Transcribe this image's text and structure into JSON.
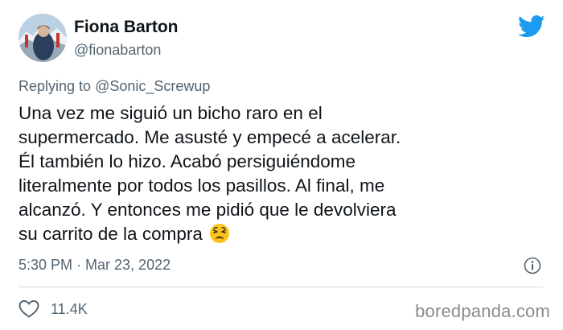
{
  "author": {
    "name": "Fiona Barton",
    "handle": "@fionabarton"
  },
  "reply": {
    "prefix": "Replying to ",
    "mention": "@Sonic_Screwup"
  },
  "tweet": {
    "lines": [
      "Una vez me siguió un bicho raro en el",
      "supermercado. Me asusté y empecé a acelerar.",
      "Él también lo hizo. Acabó persiguiéndome",
      "literalmente por todos los pasillos. Al final, me",
      "alcanzó. Y entonces me pidió que le devolviera",
      "su carrito de la compra"
    ],
    "emoji": "weary-face-emoji"
  },
  "meta": {
    "timestamp": "5:30 PM · Mar 23, 2022"
  },
  "engagement": {
    "likes": "11.4K"
  },
  "watermark": "boredpanda.com",
  "colors": {
    "twitter_blue": "#1d9bf0",
    "secondary_text": "#536471",
    "primary_text": "#0f1419"
  },
  "icons": [
    "avatar",
    "twitter-bird-icon",
    "weary-face-emoji",
    "info-icon",
    "heart-icon"
  ]
}
